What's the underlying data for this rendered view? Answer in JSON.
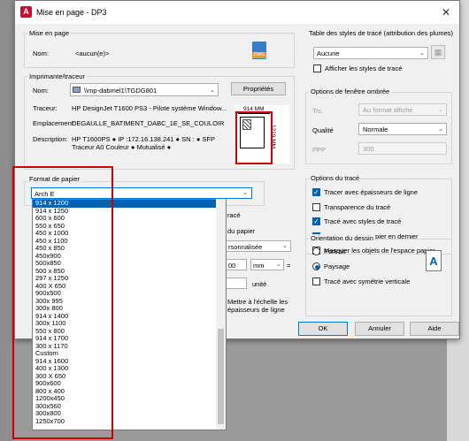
{
  "dialog": {
    "title": "Mise en page - DP3",
    "close": "✕"
  },
  "page_setup": {
    "group_label": "Mise en page",
    "name_label": "Nom:",
    "name_value": "<aucun(e)>",
    "dwg_badge": "DWG"
  },
  "plotter": {
    "group_label": "Imprimante/traceur",
    "name_label": "Nom:",
    "name_value": "\\\\mp-dabmel1\\TGDG801",
    "properties_button": "Propriétés",
    "plotter_label": "Traceur:",
    "plotter_value": "HP DesignJet T1600 PS3 - Pilote système Window...",
    "location_label": "Emplacement:",
    "location_value": "DEGAULLE_BATIMENT_DABC_1E_SE_COULOIR",
    "description_label": "Description:",
    "description_line1": "HP T1600PS ● IP :172.16.138.241 ● SN : ● SFP",
    "description_line2": "Traceur A0 Couleur ● Mutualisé ●",
    "preview_width": "914 MM",
    "preview_height": "1219 MM"
  },
  "paper_size": {
    "group_label": "Format de papier",
    "selected": "Arch E",
    "options": [
      "914 x 1200",
      "914 x 1250",
      "600 x 600",
      "550 x 650",
      "450 x 1000",
      "450 x 1100",
      "450 x 850",
      "450x900",
      "500x850",
      "500 x 850",
      "297 x 1250",
      "400 X 650",
      "900x500",
      "300x 995",
      "300x 800",
      "914 x 1400",
      "300x 1100",
      "550 x 800",
      "914 x 1700",
      "300 x 1170",
      "Custom",
      "914 x 1600",
      "400 x 1300",
      "300 X 650",
      "900x600",
      "800 x 400",
      "1200x450",
      "300x560",
      "300x800",
      "1250x700"
    ],
    "selected_option_index": 0
  },
  "partial_plot_area": {
    "label_trace": "racé",
    "label_du_papier": "du papier",
    "select_value": "rsonnalisée",
    "value_input": "00",
    "unit_select": "mm",
    "equals": "=",
    "unit_label": "unité",
    "scale_line1": "Mettre à l'échelle les",
    "scale_line2": "épaisseurs de ligne"
  },
  "plot_style_table": {
    "group_label": "Table des styles de tracé (attribution des plumes)",
    "selected": "Aucune",
    "show_styles": "Afficher les styles de tracé"
  },
  "shaded_viewport": {
    "group_label": "Options de fenêtre ombrée",
    "trace_label": "Trc.",
    "trace_value": "Au format affiché",
    "quality_label": "Qualité",
    "quality_value": "Normale",
    "ppp_label": "PPP",
    "ppp_value": "300"
  },
  "plot_options": {
    "group_label": "Options du tracé",
    "items": [
      {
        "label": "Tracer avec épaisseurs de ligne",
        "checked": true
      },
      {
        "label": "Transparence du tracé",
        "checked": false
      },
      {
        "label": "Tracé avec styles de tracé",
        "checked": true
      },
      {
        "label": "Tracer espace papier en dernier",
        "checked": true
      },
      {
        "label": "Masquer les objets de l'espace papier",
        "checked": false
      }
    ]
  },
  "orientation": {
    "group_label": "Orientation du dessin",
    "portrait": "Portrait",
    "landscape": "Paysage",
    "upside_down": "Tracé avec symétrie verticale",
    "selected": "Paysage"
  },
  "buttons": {
    "ok": "OK",
    "cancel": "Annuler",
    "help": "Aide"
  },
  "colors": {
    "accent": "#0063b1",
    "highlight_box": "#d00000",
    "brand": "#c8102e"
  }
}
